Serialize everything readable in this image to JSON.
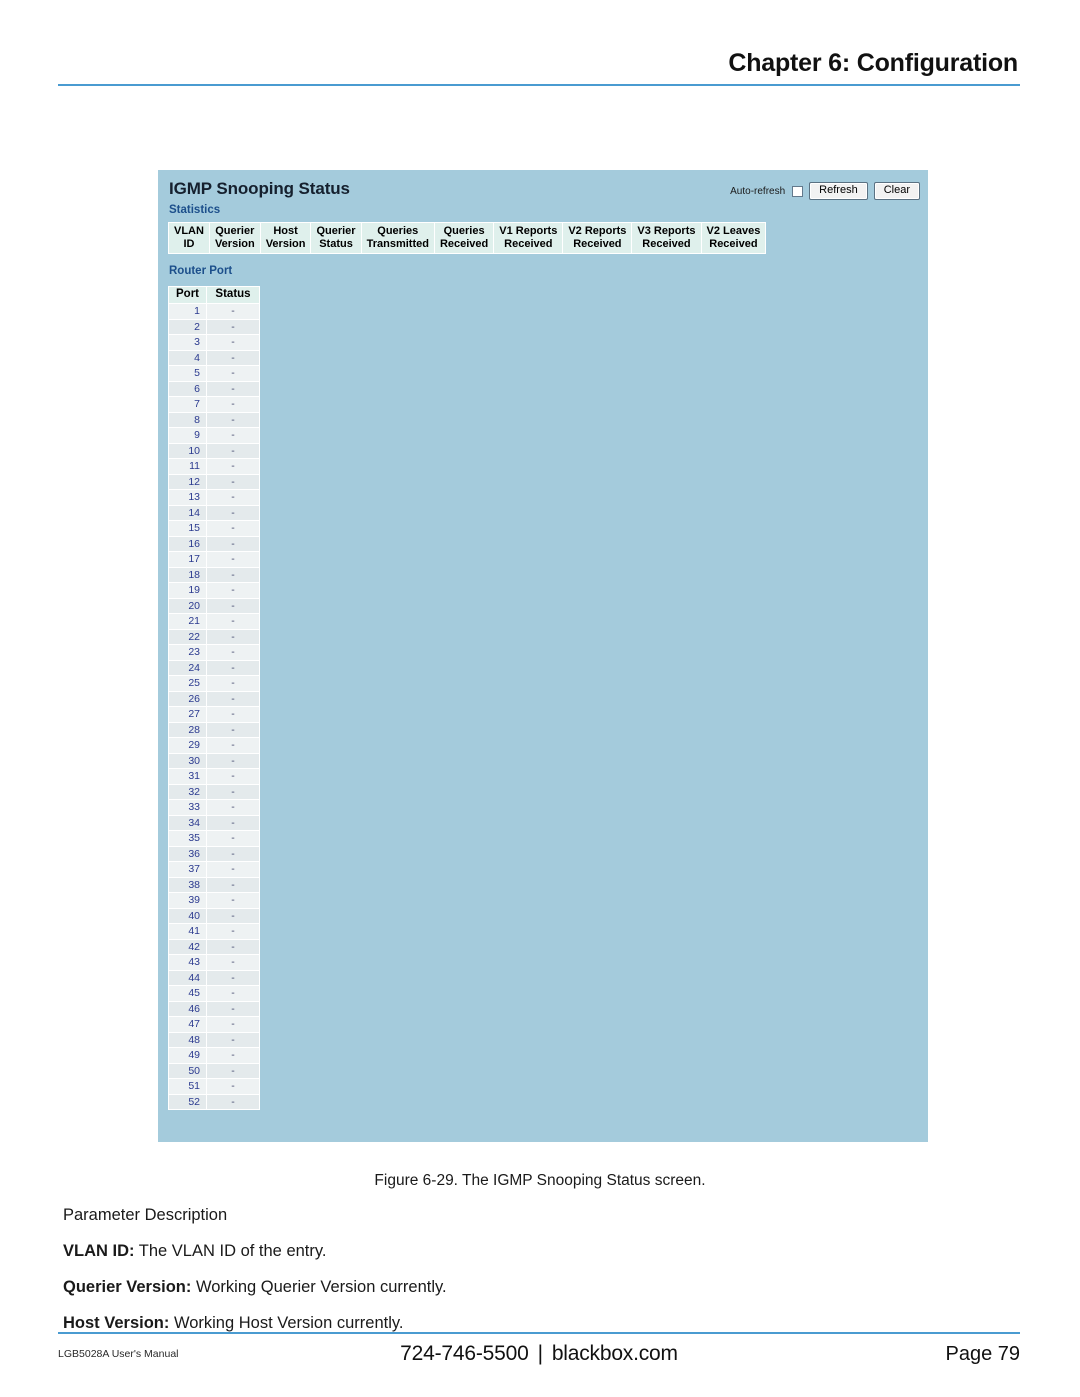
{
  "header": {
    "chapter_title": "Chapter 6: Configuration"
  },
  "screenshot": {
    "title": "IGMP Snooping Status",
    "controls": {
      "auto_refresh_label": "Auto-refresh",
      "auto_refresh_checked": false,
      "refresh_label": "Refresh",
      "clear_label": "Clear"
    },
    "statistics": {
      "section_label": "Statistics",
      "columns": [
        {
          "line1": "VLAN",
          "line2": "ID"
        },
        {
          "line1": "Querier",
          "line2": "Version"
        },
        {
          "line1": "Host",
          "line2": "Version"
        },
        {
          "line1": "Querier",
          "line2": "Status"
        },
        {
          "line1": "Queries",
          "line2": "Transmitted"
        },
        {
          "line1": "Queries",
          "line2": "Received"
        },
        {
          "line1": "V1 Reports",
          "line2": "Received"
        },
        {
          "line1": "V2 Reports",
          "line2": "Received"
        },
        {
          "line1": "V3 Reports",
          "line2": "Received"
        },
        {
          "line1": "V2 Leaves",
          "line2": "Received"
        }
      ],
      "rows": []
    },
    "router_port": {
      "section_label": "Router Port",
      "columns": [
        "Port",
        "Status"
      ],
      "rows": [
        {
          "port": "1",
          "status": "-"
        },
        {
          "port": "2",
          "status": "-"
        },
        {
          "port": "3",
          "status": "-"
        },
        {
          "port": "4",
          "status": "-"
        },
        {
          "port": "5",
          "status": "-"
        },
        {
          "port": "6",
          "status": "-"
        },
        {
          "port": "7",
          "status": "-"
        },
        {
          "port": "8",
          "status": "-"
        },
        {
          "port": "9",
          "status": "-"
        },
        {
          "port": "10",
          "status": "-"
        },
        {
          "port": "11",
          "status": "-"
        },
        {
          "port": "12",
          "status": "-"
        },
        {
          "port": "13",
          "status": "-"
        },
        {
          "port": "14",
          "status": "-"
        },
        {
          "port": "15",
          "status": "-"
        },
        {
          "port": "16",
          "status": "-"
        },
        {
          "port": "17",
          "status": "-"
        },
        {
          "port": "18",
          "status": "-"
        },
        {
          "port": "19",
          "status": "-"
        },
        {
          "port": "20",
          "status": "-"
        },
        {
          "port": "21",
          "status": "-"
        },
        {
          "port": "22",
          "status": "-"
        },
        {
          "port": "23",
          "status": "-"
        },
        {
          "port": "24",
          "status": "-"
        },
        {
          "port": "25",
          "status": "-"
        },
        {
          "port": "26",
          "status": "-"
        },
        {
          "port": "27",
          "status": "-"
        },
        {
          "port": "28",
          "status": "-"
        },
        {
          "port": "29",
          "status": "-"
        },
        {
          "port": "30",
          "status": "-"
        },
        {
          "port": "31",
          "status": "-"
        },
        {
          "port": "32",
          "status": "-"
        },
        {
          "port": "33",
          "status": "-"
        },
        {
          "port": "34",
          "status": "-"
        },
        {
          "port": "35",
          "status": "-"
        },
        {
          "port": "36",
          "status": "-"
        },
        {
          "port": "37",
          "status": "-"
        },
        {
          "port": "38",
          "status": "-"
        },
        {
          "port": "39",
          "status": "-"
        },
        {
          "port": "40",
          "status": "-"
        },
        {
          "port": "41",
          "status": "-"
        },
        {
          "port": "42",
          "status": "-"
        },
        {
          "port": "43",
          "status": "-"
        },
        {
          "port": "44",
          "status": "-"
        },
        {
          "port": "45",
          "status": "-"
        },
        {
          "port": "46",
          "status": "-"
        },
        {
          "port": "47",
          "status": "-"
        },
        {
          "port": "48",
          "status": "-"
        },
        {
          "port": "49",
          "status": "-"
        },
        {
          "port": "50",
          "status": "-"
        },
        {
          "port": "51",
          "status": "-"
        },
        {
          "port": "52",
          "status": "-"
        }
      ]
    }
  },
  "figure": {
    "caption": "Figure 6-29. The IGMP Snooping Status screen."
  },
  "body": {
    "heading": "Parameter Description",
    "parameters": [
      {
        "term": "VLAN ID:",
        "description": "The VLAN ID of the entry."
      },
      {
        "term": "Querier Version:",
        "description": "Working Querier Version currently."
      },
      {
        "term": "Host Version:",
        "description": "Working Host Version currently."
      }
    ]
  },
  "footer": {
    "left": "LGB5028A User's Manual",
    "phone": "724-746-5500",
    "separator": "|",
    "website": "blackbox.com",
    "page": "Page 79"
  },
  "colors": {
    "rule": "#4a9bd1",
    "panel_bg": "#a4cbdc",
    "section_label": "#1c4f8b",
    "table_header_bg": "#dff0ec",
    "port_value": "#2b3a8f"
  }
}
